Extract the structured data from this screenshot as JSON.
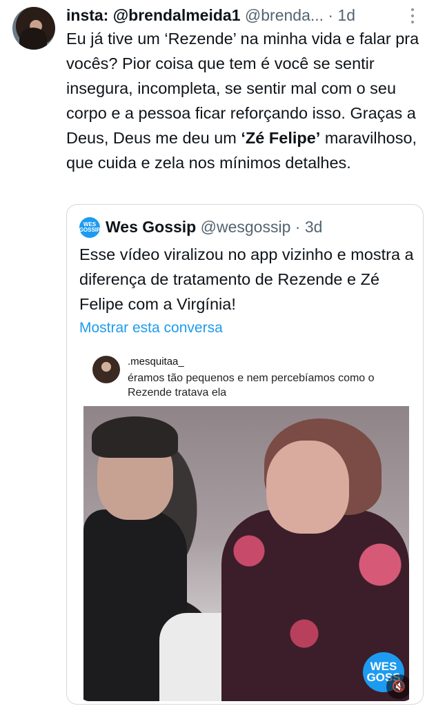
{
  "tweet": {
    "display_name": "insta: @brendalmeida1",
    "handle": "@brenda...",
    "separator": "·",
    "time": "1d",
    "text_before": "Eu já tive um ‘Rezende’ na minha vida e falar pra vocês? Pior coisa que tem é você se sentir insegura, incompleta, se sentir mal com o seu corpo e a pessoa ficar reforçando isso. Graças a Deus, Deus me deu um ",
    "text_bold": "‘Zé Felipe’",
    "text_after": " maravilhoso, que cuida e zela nos mínimos detalhes."
  },
  "quote": {
    "avatar_text": "WES GOSSIP",
    "display_name": "Wes Gossip",
    "handle": "@wesgossip",
    "separator": "·",
    "time": "3d",
    "text": "Esse vídeo viralizou no app vizinho e mostra a diferença de tratamento de Rezende e Zé Felipe com a Virgínia!",
    "show_thread": "Mostrar esta conversa"
  },
  "media": {
    "username": ".mesquitaa_",
    "caption": "éramos tão pequenos e nem percebíamos como o Rezende tratava ela",
    "watermark": "WES GOSS"
  },
  "icons": {
    "more": "more-vertical-icon",
    "mute": "volume-muted-icon"
  },
  "colors": {
    "accent": "#1d9bf0",
    "text": "#0f1419",
    "secondary": "#536471"
  }
}
